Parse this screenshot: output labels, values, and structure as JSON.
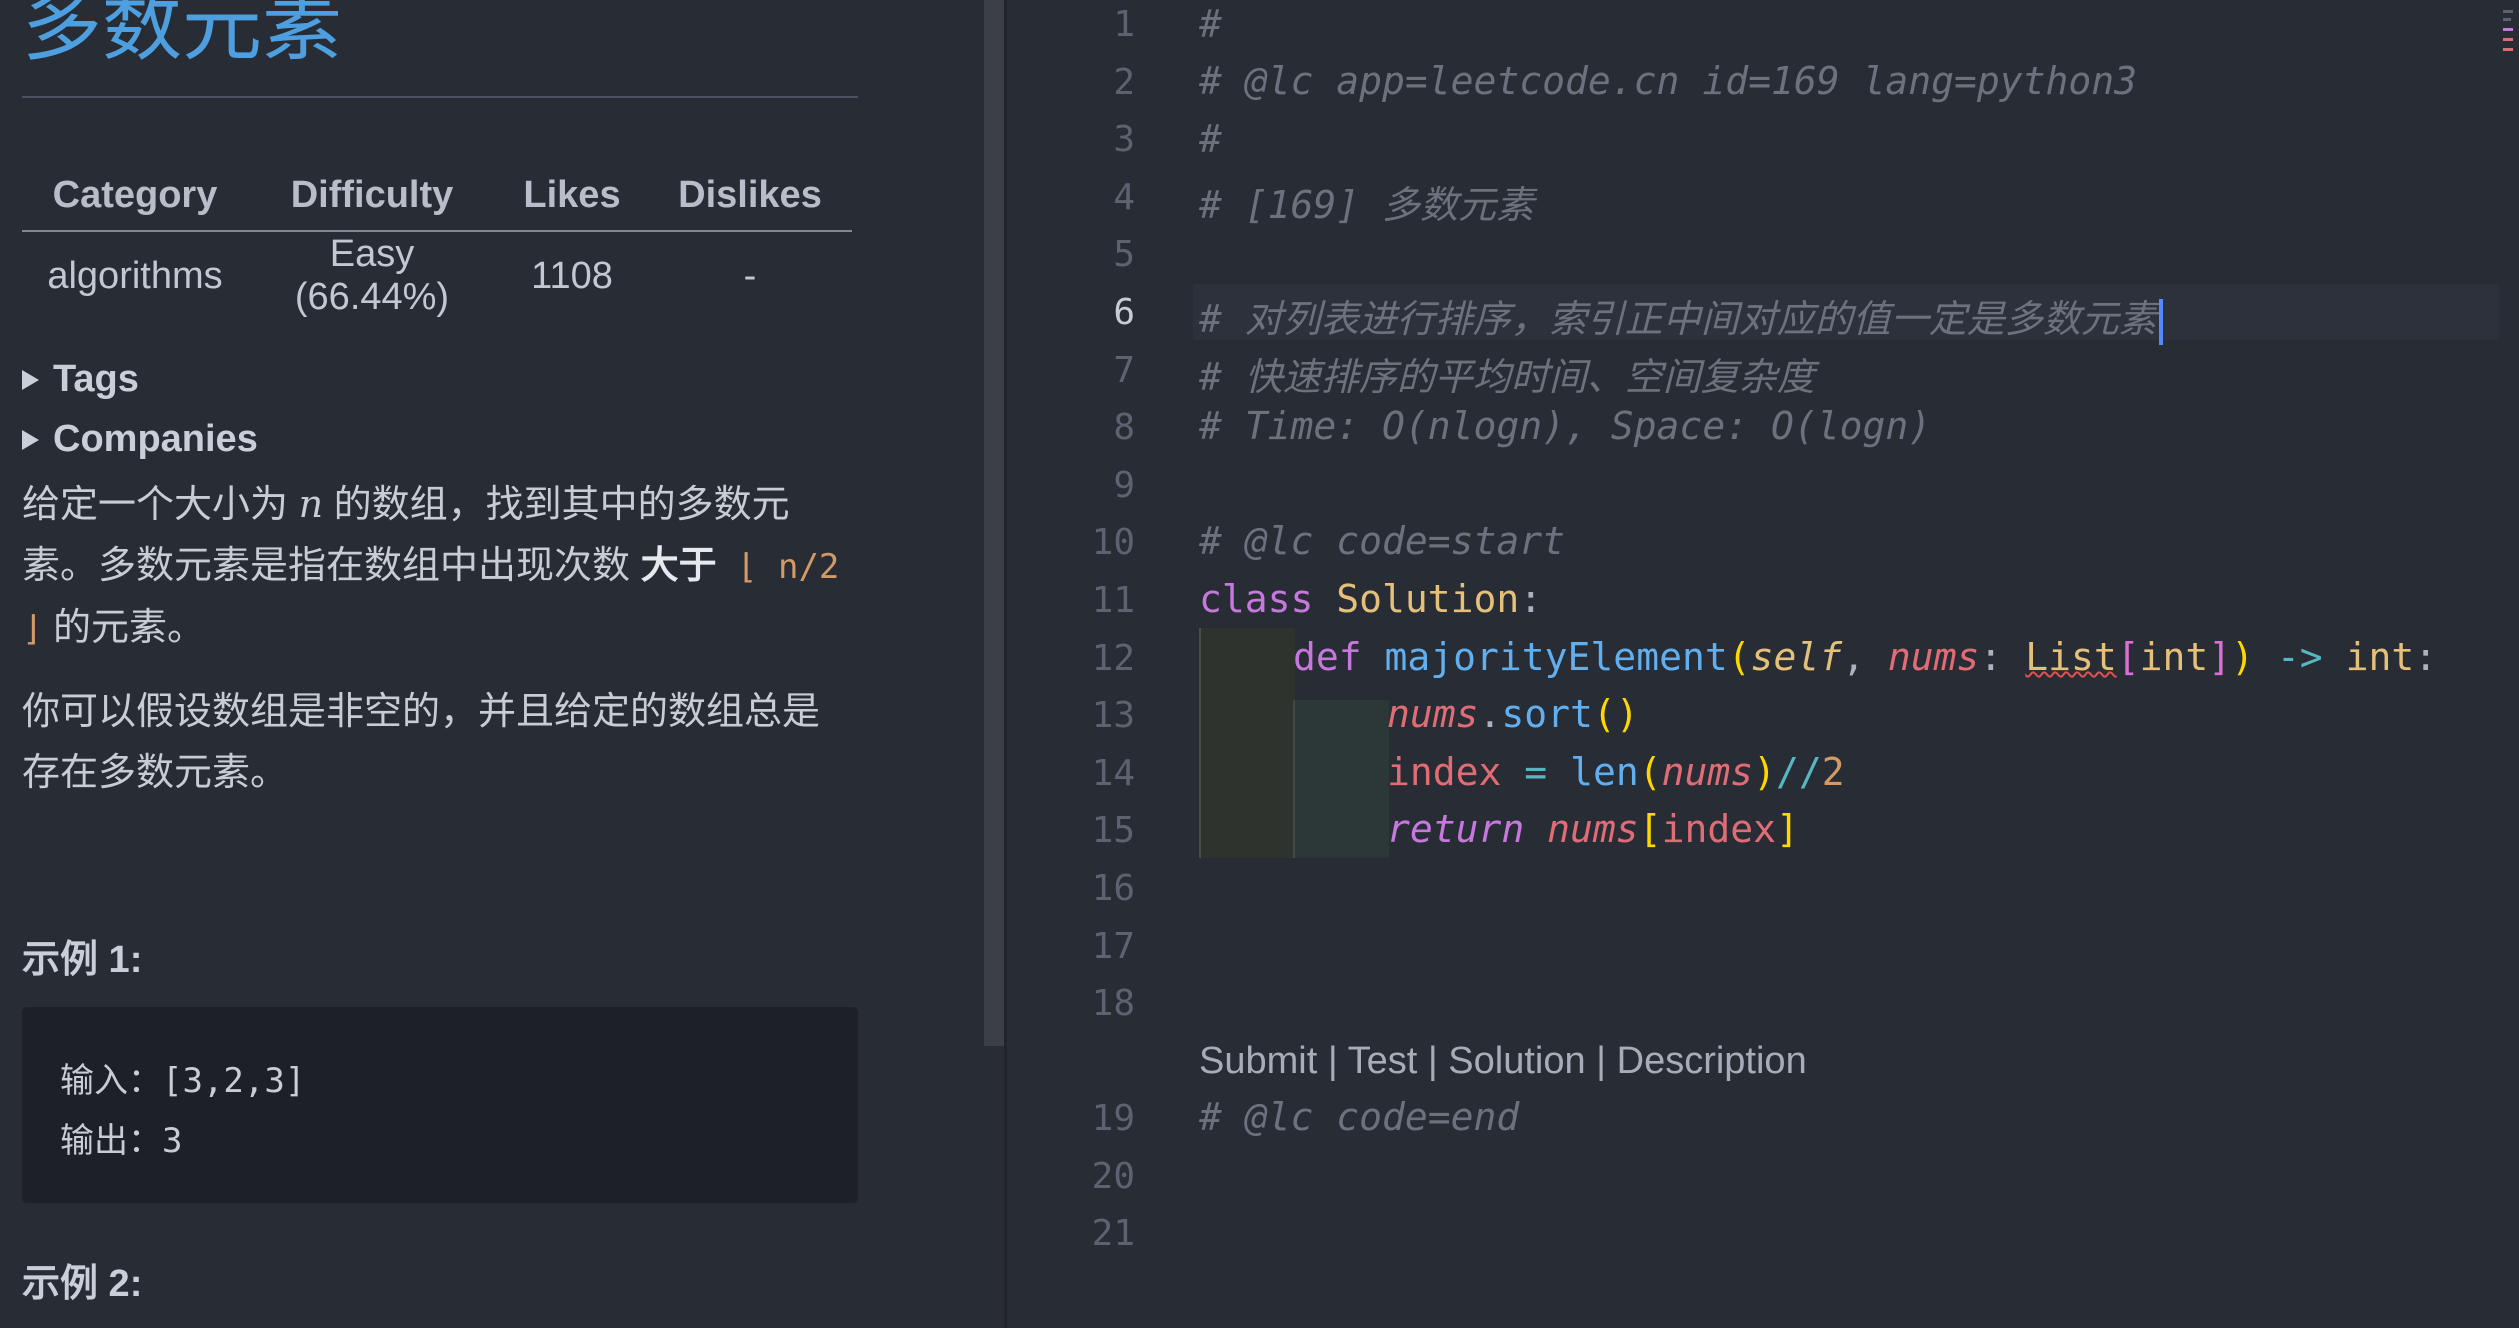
{
  "problem": {
    "title": "多数元素",
    "table": {
      "headers": [
        "Category",
        "Difficulty",
        "Likes",
        "Dislikes"
      ],
      "row": [
        "algorithms",
        "Easy (66.44%)",
        "1108",
        "-"
      ]
    },
    "tags_label": "Tags",
    "companies_label": "Companies",
    "desc1": {
      "a": "给定一个大小为 ",
      "n": "n",
      "b": " 的数组，找到其中的多数元素。多数元素是指在数组中出现次数 ",
      "bold": "大于",
      "floor": " ⌊ n/2 ⌋",
      "c": " 的元素。"
    },
    "desc2": "你可以假设数组是非空的，并且给定的数组总是存在多数元素。",
    "example1": {
      "heading": "示例 1:",
      "input": "输入：[3,2,3]",
      "output": "输出：3"
    },
    "example2_heading": "示例 2:"
  },
  "editor": {
    "line_numbers": [
      "1",
      "2",
      "3",
      "4",
      "5",
      "6",
      "7",
      "8",
      "9",
      "10",
      "11",
      "12",
      "13",
      "14",
      "15",
      "16",
      "17",
      "18",
      "19",
      "20",
      "21"
    ],
    "current_line": "6",
    "lines": {
      "l1": "#",
      "l2": "# @lc app=leetcode.cn id=169 lang=python3",
      "l3": "#",
      "l4": "# [169] 多数元素",
      "l6": "# 对列表进行排序，索引正中间对应的值一定是多数元素",
      "l7": "# 快速排序的平均时间、空间复杂度",
      "l8": "# Time: O(nlogn), Space: O(logn)",
      "l10": "# @lc code=start",
      "l19": "# @lc code=end"
    },
    "tokens": {
      "class_kw": "class",
      "class_name": "Solution",
      "colon": ":",
      "def_kw": "def",
      "fn_name": "majorityElement",
      "paren_open": "(",
      "paren_close": ")",
      "self": "self",
      "comma": ",",
      "nums": "nums",
      "list_type": "List",
      "bracket_open": "[",
      "bracket_close": "]",
      "int": "int",
      "arrow": "->",
      "dot": ".",
      "sort": "sort",
      "index": "index",
      "eq": "=",
      "len": "len",
      "floordiv": "//",
      "two": "2",
      "return_kw": "return"
    },
    "codelens": {
      "submit": "Submit",
      "test": "Test",
      "solution": "Solution",
      "description": "Description",
      "sep": " | "
    }
  }
}
